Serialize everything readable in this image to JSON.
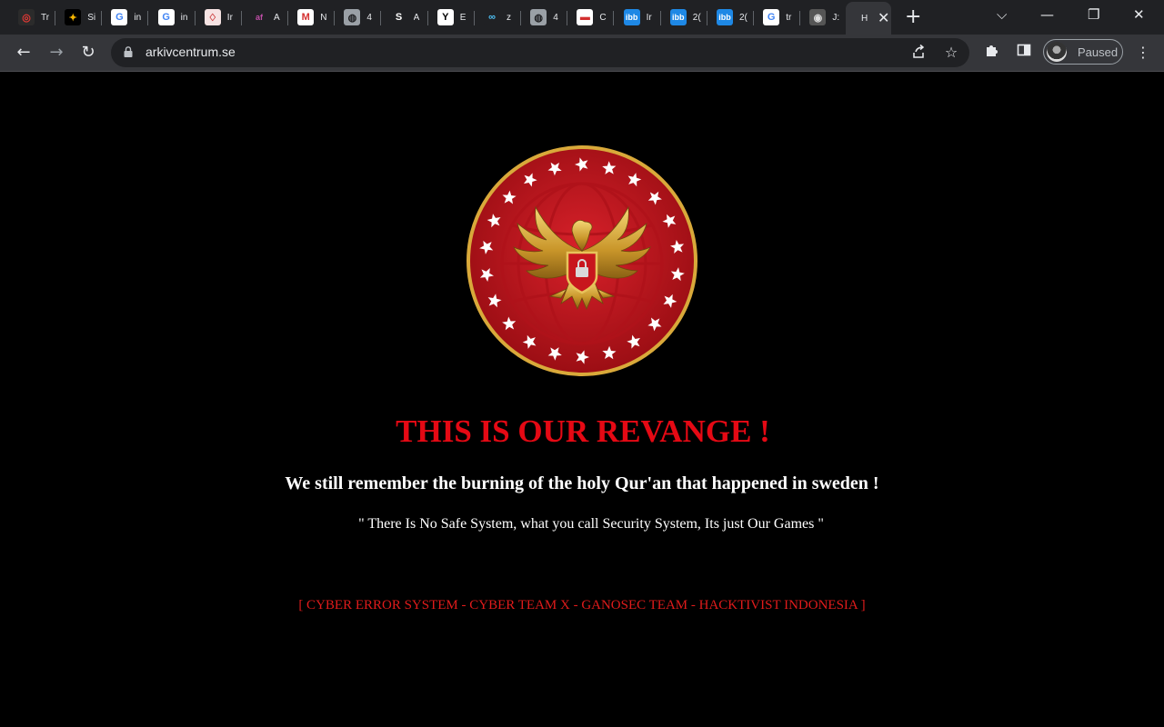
{
  "browser": {
    "tabs": [
      {
        "title": "Tr",
        "icon": "target-icon",
        "bg": "#2b2b2b",
        "fg": "#e53935",
        "glyph": "◎"
      },
      {
        "title": "Si",
        "icon": "sparkle-icon",
        "bg": "#000000",
        "fg": "#f4b400",
        "glyph": "✦"
      },
      {
        "title": "in",
        "icon": "google-icon",
        "bg": "#ffffff",
        "fg": "#4285f4",
        "glyph": "G"
      },
      {
        "title": "in",
        "icon": "google-icon",
        "bg": "#ffffff",
        "fg": "#4285f4",
        "glyph": "G"
      },
      {
        "title": "Ir",
        "icon": "badge-icon",
        "bg": "#f6e3e3",
        "fg": "#c62828",
        "glyph": "♢"
      },
      {
        "title": "A",
        "icon": "af-logo-icon",
        "bg": "#202124",
        "fg": "#c04ea8",
        "glyph": "af"
      },
      {
        "title": "N",
        "icon": "m-logo-icon",
        "bg": "#ffffff",
        "fg": "#d32f2f",
        "glyph": "M"
      },
      {
        "title": "4",
        "icon": "globe-icon",
        "bg": "#9aa0a6",
        "fg": "#202124",
        "glyph": "◍"
      },
      {
        "title": "A",
        "icon": "s-logo-icon",
        "bg": "#202124",
        "fg": "#ffffff",
        "glyph": "S"
      },
      {
        "title": "E",
        "icon": "y-logo-icon",
        "bg": "#ffffff",
        "fg": "#000000",
        "glyph": "Y"
      },
      {
        "title": "z",
        "icon": "link-icon",
        "bg": "#202124",
        "fg": "#4fc3f7",
        "glyph": "∞"
      },
      {
        "title": "4",
        "icon": "globe-icon",
        "bg": "#9aa0a6",
        "fg": "#202124",
        "glyph": "◍"
      },
      {
        "title": "C",
        "icon": "flag-icon",
        "bg": "#ffffff",
        "fg": "#d32f2f",
        "glyph": "▬"
      },
      {
        "title": "Ir",
        "icon": "ibb-logo-icon",
        "bg": "#1e88e5",
        "fg": "#ffffff",
        "glyph": "ibb"
      },
      {
        "title": "2(",
        "icon": "ibb-logo-icon",
        "bg": "#1e88e5",
        "fg": "#ffffff",
        "glyph": "ibb"
      },
      {
        "title": "2(",
        "icon": "ibb-logo-icon",
        "bg": "#1e88e5",
        "fg": "#ffffff",
        "glyph": "ibb"
      },
      {
        "title": "tr",
        "icon": "google-icon",
        "bg": "#ffffff",
        "fg": "#4285f4",
        "glyph": "G"
      },
      {
        "title": "J:",
        "icon": "avatar-icon",
        "bg": "#555555",
        "fg": "#dddddd",
        "glyph": "◉"
      }
    ],
    "active_tab": {
      "title": "H",
      "close": "✕"
    },
    "new_tab": "+",
    "window_controls": {
      "menu": "⌵",
      "minimize": "—",
      "restore": "❐",
      "close": "✕"
    },
    "nav": {
      "back": "←",
      "forward": "→",
      "reload": "↻"
    },
    "url": "arkivcentrum.se",
    "profile_label": "Paused"
  },
  "page": {
    "headline": "THIS IS OUR REVANGE !",
    "subline": "We still remember the burning of the holy Qur'an that happened in sweden !",
    "quote": "\" There Is No Safe System, what you call Security System, Its just Our Games \"",
    "teams": "[ CYBER ERROR SYSTEM - CYBER TEAM X - GANOSEC TEAM - HACKTIVIST INDONESIA ]"
  },
  "colors": {
    "headline": "#e50914",
    "teams": "#e01b1b",
    "emblem_red": "#c8161d",
    "emblem_gold": "#d4a830"
  }
}
